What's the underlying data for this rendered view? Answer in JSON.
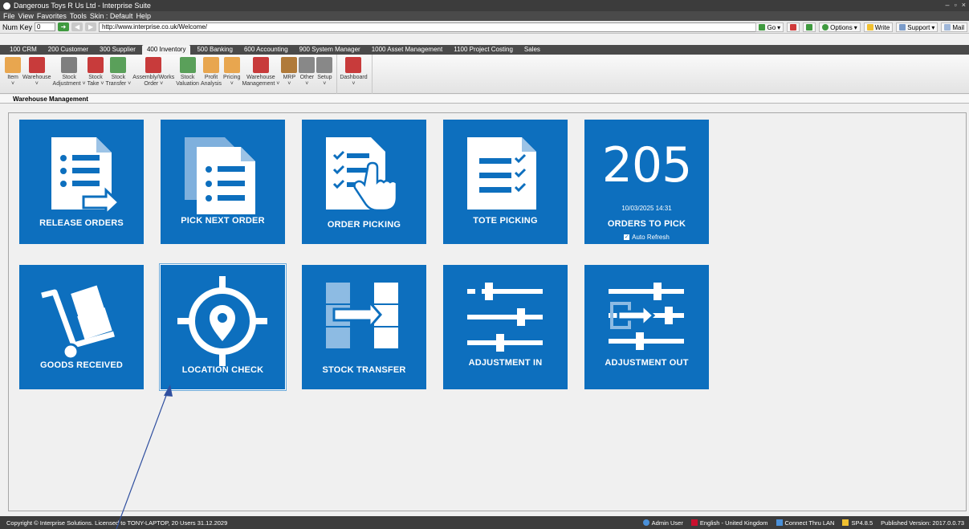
{
  "window": {
    "title": "Dangerous Toys R Us Ltd - Interprise Suite",
    "controls": [
      "–",
      "▫",
      "×"
    ]
  },
  "menu": [
    "File",
    "View",
    "Favorites",
    "Tools",
    "Skin : Default",
    "Help"
  ],
  "address": {
    "numkey_label": "Num Key",
    "numkey_value": "0",
    "url": "http://www.interprise.co.uk/Welcome/",
    "go_label": "Go",
    "options_label": "Options",
    "write_label": "Write",
    "support_label": "Support",
    "mail_label": "Mail"
  },
  "module_tabs": [
    "100 CRM",
    "200 Customer",
    "300 Supplier",
    "400 Inventory",
    "500 Banking",
    "600 Accounting",
    "900 System Manager",
    "1000 Asset Management",
    "1100 Project Costing",
    "Sales"
  ],
  "active_module": "400 Inventory",
  "ribbon": {
    "items": [
      {
        "label": "Item",
        "sub": "˅",
        "icon": "item-icon",
        "color": "#e8a64f"
      },
      {
        "label": "Warehouse",
        "sub": "˅",
        "icon": "warehouse-icon",
        "color": "#c83b3b"
      },
      {
        "label": "Stock",
        "sub": "Adjustment ˅",
        "icon": "stock-adjustment-icon",
        "color": "#7f7f7f"
      },
      {
        "label": "Stock",
        "sub": "Take ˅",
        "icon": "stock-take-icon",
        "color": "#c83b3b"
      },
      {
        "label": "Stock",
        "sub": "Transfer ˅",
        "icon": "stock-transfer-icon",
        "color": "#5aa05a"
      },
      {
        "label": "Assembly/Works",
        "sub": "Order ˅",
        "icon": "assembly-icon",
        "color": "#c83b3b"
      },
      {
        "label": "Stock",
        "sub": "Valuation",
        "icon": "stock-valuation-icon",
        "color": "#5aa05a"
      },
      {
        "label": "Profit",
        "sub": "Analysis",
        "icon": "profit-analysis-icon",
        "color": "#e8a64f"
      },
      {
        "label": "Pricing",
        "sub": "˅",
        "icon": "pricing-icon",
        "color": "#e8a64f"
      },
      {
        "label": "Warehouse",
        "sub": "Management ˅",
        "icon": "warehouse-management-icon",
        "color": "#c83b3b"
      },
      {
        "label": "MRP",
        "sub": "˅",
        "icon": "mrp-icon",
        "color": "#b07a3a"
      },
      {
        "label": "Other",
        "sub": "˅",
        "icon": "other-icon",
        "color": "#888888"
      },
      {
        "label": "Setup",
        "sub": "˅",
        "icon": "setup-icon",
        "color": "#888888"
      },
      {
        "label": "Dashboard",
        "sub": "˅",
        "icon": "dashboard-icon",
        "color": "#c83b3b"
      }
    ]
  },
  "panel": {
    "title": "Warehouse Management"
  },
  "tiles": [
    {
      "label": "RELEASE ORDERS",
      "icon": "release-orders-icon"
    },
    {
      "label": "PICK NEXT ORDER",
      "icon": "pick-next-order-icon"
    },
    {
      "label": "ORDER PICKING",
      "icon": "order-picking-icon"
    },
    {
      "label": "TOTE PICKING",
      "icon": "tote-picking-icon"
    },
    {
      "label": "ORDERS TO PICK",
      "count": "205",
      "timestamp": "10/03/2025 14:31",
      "auto_refresh_label": "Auto Refresh",
      "auto_refresh": true
    },
    {
      "label": "GOODS RECEIVED",
      "icon": "goods-received-icon"
    },
    {
      "label": "LOCATION CHECK",
      "icon": "location-check-icon",
      "selected": true
    },
    {
      "label": "STOCK TRANSFER",
      "icon": "stock-transfer-icon"
    },
    {
      "label": "ADJUSTMENT IN",
      "icon": "adjustment-in-icon"
    },
    {
      "label": "ADJUSTMENT OUT",
      "icon": "adjustment-out-icon"
    }
  ],
  "status": {
    "copyright": "Copyright © Interprise Solutions. Licensed to TONY-LAPTOP, 20 Users 31.12.2029",
    "user": "Admin User",
    "language": "English - United Kingdom",
    "connection": "Connect Thru LAN",
    "service_pack": "SP4.8.5",
    "version": "Published Version: 2017.0.0.73"
  },
  "colors": {
    "tile_blue": "#0d6fbe",
    "chrome_dark": "#3c3c3c",
    "annotation_arrow": "#2f4f9f"
  }
}
